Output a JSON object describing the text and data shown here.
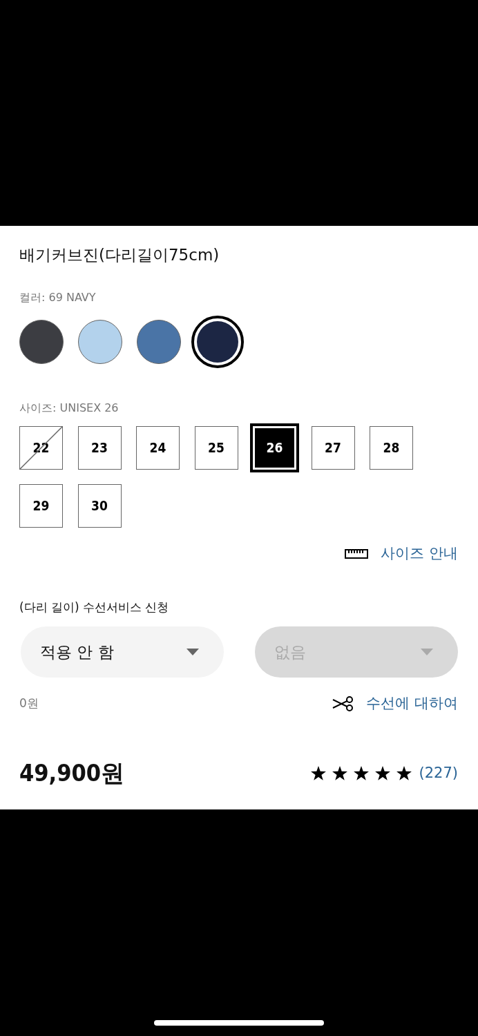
{
  "product": {
    "title": "배기커브진(다리길이75cm)"
  },
  "color": {
    "label": "컬러: 69 NAVY",
    "swatches": [
      {
        "color": "#3c3d42",
        "selected": false
      },
      {
        "color": "#b3d2ec",
        "selected": false
      },
      {
        "color": "#4a74a6",
        "selected": false
      },
      {
        "color": "#1c2644",
        "selected": true
      }
    ]
  },
  "size": {
    "label": "사이즈: UNISEX 26",
    "options": [
      {
        "label": "22",
        "available": false,
        "selected": false
      },
      {
        "label": "23",
        "available": true,
        "selected": false
      },
      {
        "label": "24",
        "available": true,
        "selected": false
      },
      {
        "label": "25",
        "available": true,
        "selected": false
      },
      {
        "label": "26",
        "available": true,
        "selected": true
      },
      {
        "label": "27",
        "available": true,
        "selected": false
      },
      {
        "label": "28",
        "available": true,
        "selected": false
      },
      {
        "label": "29",
        "available": true,
        "selected": false
      },
      {
        "label": "30",
        "available": true,
        "selected": false
      }
    ],
    "guide_link": "사이즈 안내"
  },
  "alteration": {
    "label": "(다리 길이) 수선서비스 신청",
    "selects": [
      {
        "value": "적용 안 함",
        "disabled": false
      },
      {
        "value": "없음",
        "disabled": true
      }
    ],
    "fee": "0원",
    "info_link": "수선에 대하여"
  },
  "price": "49,900원",
  "rating": {
    "stars": 5,
    "count": "(227)"
  }
}
